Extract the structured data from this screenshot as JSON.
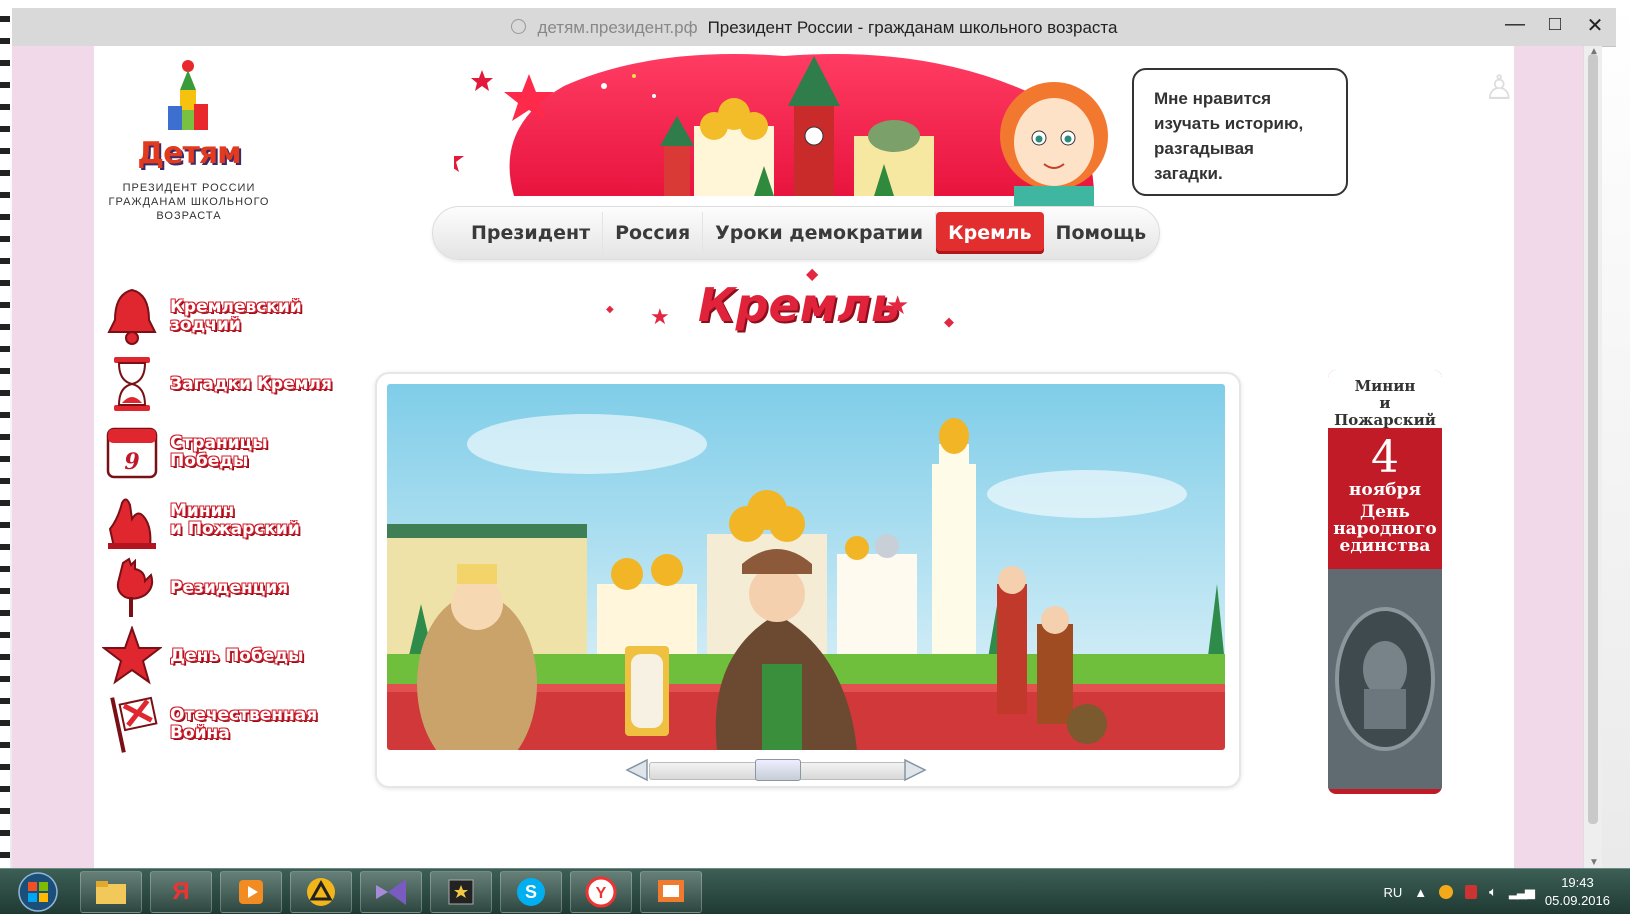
{
  "window": {
    "host": "детям.президент.рф",
    "title": "Президент России - гражданам школьного возраста",
    "controls": {
      "minimize": "—",
      "maximize": "□",
      "close": "✕"
    }
  },
  "site": {
    "logo_text": "Детям",
    "logo_sub_line1": "ПРЕЗИДЕНТ РОССИИ",
    "logo_sub_line2": "ГРАЖДАНАМ ШКОЛЬНОГО",
    "logo_sub_line3": "ВОЗРАСТА"
  },
  "speech": {
    "line1": "Мне нравится",
    "line2": "изучать историю,",
    "line3": "разгадывая",
    "line4": "загадки."
  },
  "nav": {
    "tabs": [
      {
        "label": "Президент"
      },
      {
        "label": "Россия"
      },
      {
        "label": "Уроки демократии"
      },
      {
        "label": "Кремль",
        "active": true
      },
      {
        "label": "Помощь"
      }
    ]
  },
  "page_title": "Кремль",
  "sidebar": {
    "items": [
      {
        "line1": "Кремлевский",
        "line2": "зодчий",
        "icon": "bell-icon"
      },
      {
        "line1": "Загадки Кремля",
        "line2": "",
        "icon": "hourglass-icon"
      },
      {
        "line1": "Страницы",
        "line2": "Победы",
        "icon": "calendar-icon",
        "icon_text": "9"
      },
      {
        "line1": "Минин",
        "line2": "и Пожарский",
        "icon": "monument-icon"
      },
      {
        "line1": "Резиденция",
        "line2": "",
        "icon": "rooster-icon"
      },
      {
        "line1": "День Победы",
        "line2": "",
        "icon": "star-icon"
      },
      {
        "line1": "Отечественная",
        "line2": "Война",
        "icon": "flag-icon"
      }
    ]
  },
  "slider": {
    "position": 0.5
  },
  "banner": {
    "title_line1": "Минин",
    "title_line2": "и Пожарский",
    "day": "4",
    "month": "ноября",
    "holiday_line1": "День",
    "holiday_line2": "народного",
    "holiday_line3": "единства"
  },
  "taskbar": {
    "apps": [
      "file-explorer-icon",
      "yandex-icon",
      "media-player-icon",
      "triangle-app-icon",
      "visual-studio-icon",
      "film-app-icon",
      "skype-icon",
      "yandex-browser-icon",
      "presentation-icon"
    ],
    "lang": "RU",
    "time": "19:43",
    "date": "05.09.2016"
  },
  "colors": {
    "accent": "#e22e2e",
    "page_bg": "#f1d9ea"
  }
}
